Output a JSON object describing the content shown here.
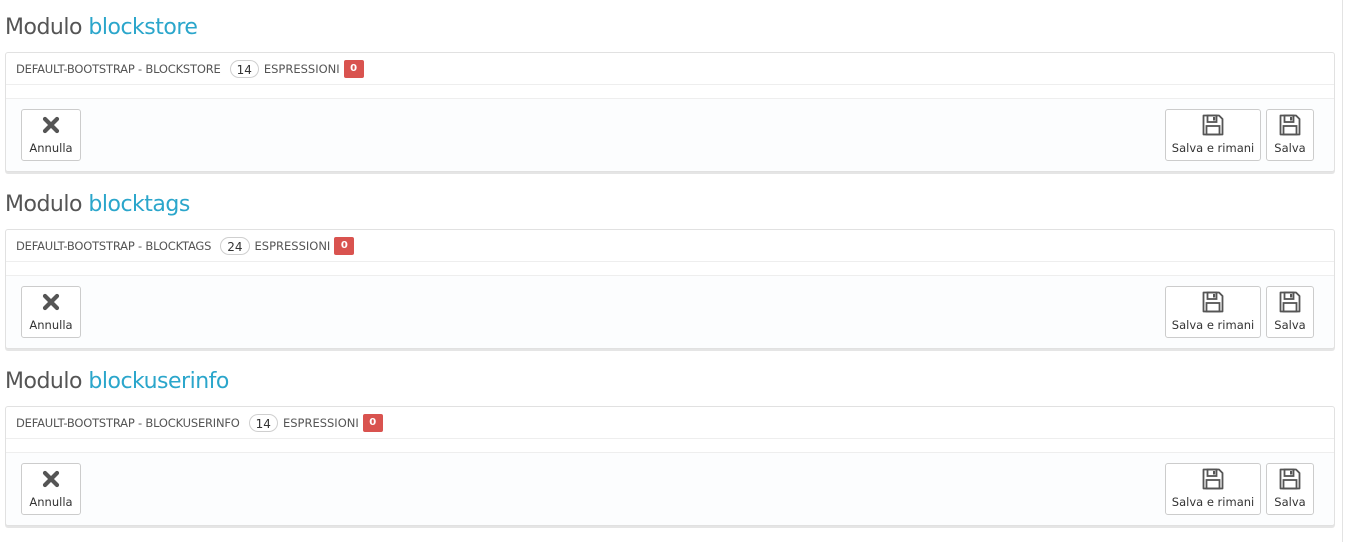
{
  "sections": [
    {
      "title_prefix": "Modulo",
      "module_name": "blockstore",
      "theme_label": "DEFAULT-BOOTSTRAP - BLOCKSTORE",
      "expression_count": "14",
      "expressions_label": "ESPRESSIONI",
      "missing_count": "0",
      "cancel_label": "Annulla",
      "save_stay_label": "Salva e rimani",
      "save_label": "Salva"
    },
    {
      "title_prefix": "Modulo",
      "module_name": "blocktags",
      "theme_label": "DEFAULT-BOOTSTRAP - BLOCKTAGS",
      "expression_count": "24",
      "expressions_label": "ESPRESSIONI",
      "missing_count": "0",
      "cancel_label": "Annulla",
      "save_stay_label": "Salva e rimani",
      "save_label": "Salva"
    },
    {
      "title_prefix": "Modulo",
      "module_name": "blockuserinfo",
      "theme_label": "DEFAULT-BOOTSTRAP - BLOCKUSERINFO",
      "expression_count": "14",
      "expressions_label": "ESPRESSIONI",
      "missing_count": "0",
      "cancel_label": "Annulla",
      "save_stay_label": "Salva e rimani",
      "save_label": "Salva"
    }
  ],
  "icons": {
    "cancel": "close-icon",
    "save_stay": "floppy-disk-icon",
    "save": "floppy-disk-icon"
  },
  "colors": {
    "module_name": "#2ba6cb",
    "missing_badge": "#d9534f"
  }
}
